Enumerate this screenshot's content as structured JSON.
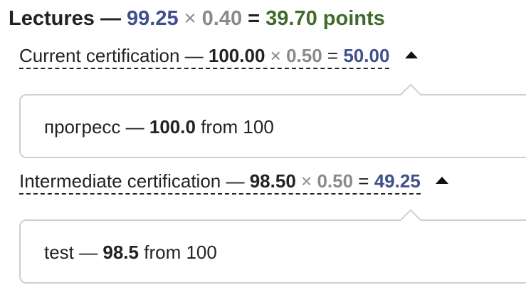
{
  "summary": {
    "label": "Lectures",
    "dash": "—",
    "score": "99.25",
    "times": "×",
    "weight": "0.40",
    "equals": "=",
    "result": "39.70 points"
  },
  "certifications": [
    {
      "name": "Current certification",
      "dash": "—",
      "score": "100.00",
      "times": "×",
      "weight": "0.50",
      "equals": "=",
      "result": "50.00",
      "details": {
        "item": "прогресс",
        "dash": "—",
        "value": "100.0",
        "suffix": "from 100"
      }
    },
    {
      "name": "Intermediate certification",
      "dash": "—",
      "score": "98.50",
      "times": "×",
      "weight": "0.50",
      "equals": "=",
      "result": "49.25",
      "details": {
        "item": "test",
        "dash": "—",
        "value": "98.5",
        "suffix": "from 100"
      }
    }
  ],
  "colors": {
    "score": "#40508e",
    "weight": "#8a8a8a",
    "total": "#3f6b2a",
    "panel_border": "#cfcfcf"
  },
  "icons": {
    "collapse": "caret-up-icon"
  }
}
